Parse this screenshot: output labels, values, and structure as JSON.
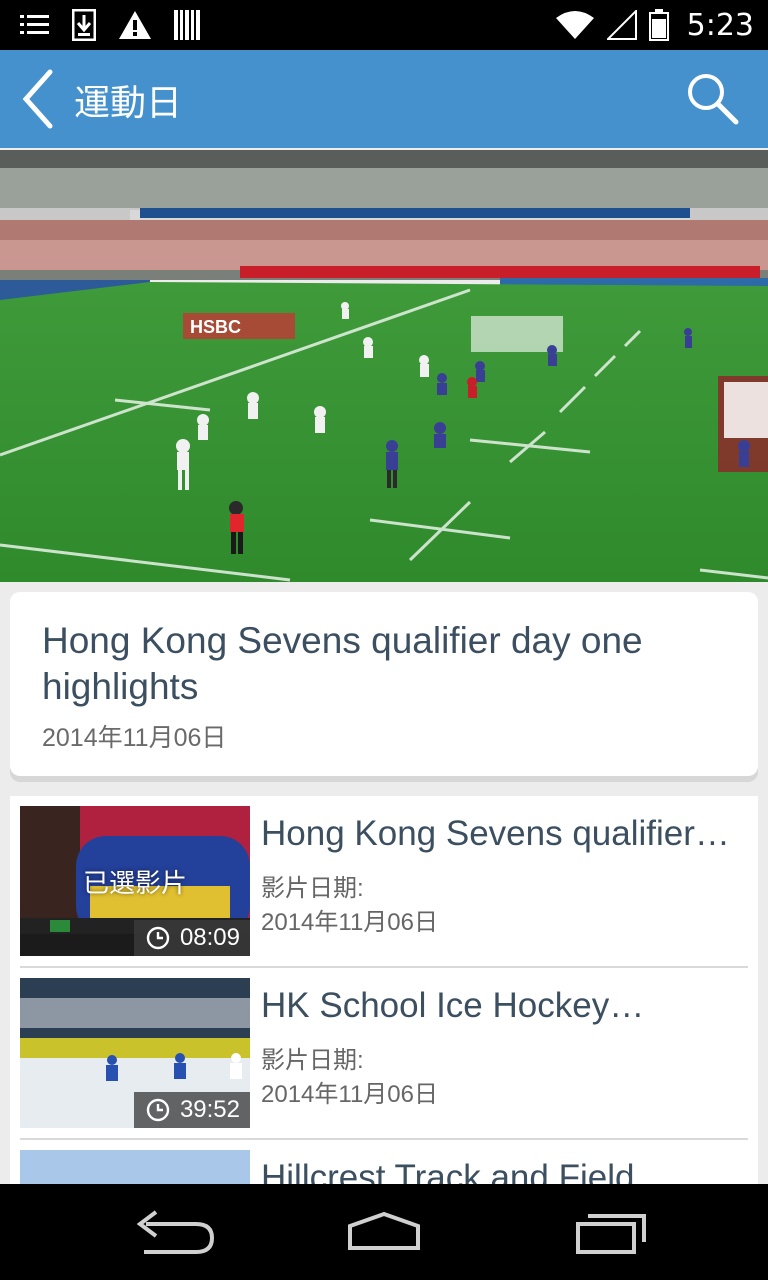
{
  "status_bar": {
    "time": "5:23",
    "icons": [
      "list-icon",
      "download-icon",
      "warning-icon",
      "barcode-icon",
      "wifi-icon",
      "signal-icon",
      "battery-icon"
    ]
  },
  "action_bar": {
    "title": "運動日",
    "back_icon": "chevron-left-icon",
    "search_icon": "search-icon",
    "color": "#4591ce"
  },
  "hero": {
    "description_icon": "video-hero"
  },
  "card": {
    "title": "Hong Kong Sevens qualifier day one highlights",
    "date": "2014年11月06日"
  },
  "list": {
    "items": [
      {
        "title": "Hong Kong Sevens qualifier…",
        "date_label": "影片日期:",
        "date": "2014年11月06日",
        "duration": "08:09",
        "overlay": "已選影片"
      },
      {
        "title": "HK School Ice Hockey…",
        "date_label": "影片日期:",
        "date": "2014年11月06日",
        "duration": "39:52"
      },
      {
        "title": "Hillcrest Track and Field",
        "date_label": "",
        "date": "",
        "duration": ""
      }
    ]
  },
  "colors": {
    "accent": "#4591ce",
    "text_dark": "#3b4f60",
    "text_muted": "#666666"
  }
}
